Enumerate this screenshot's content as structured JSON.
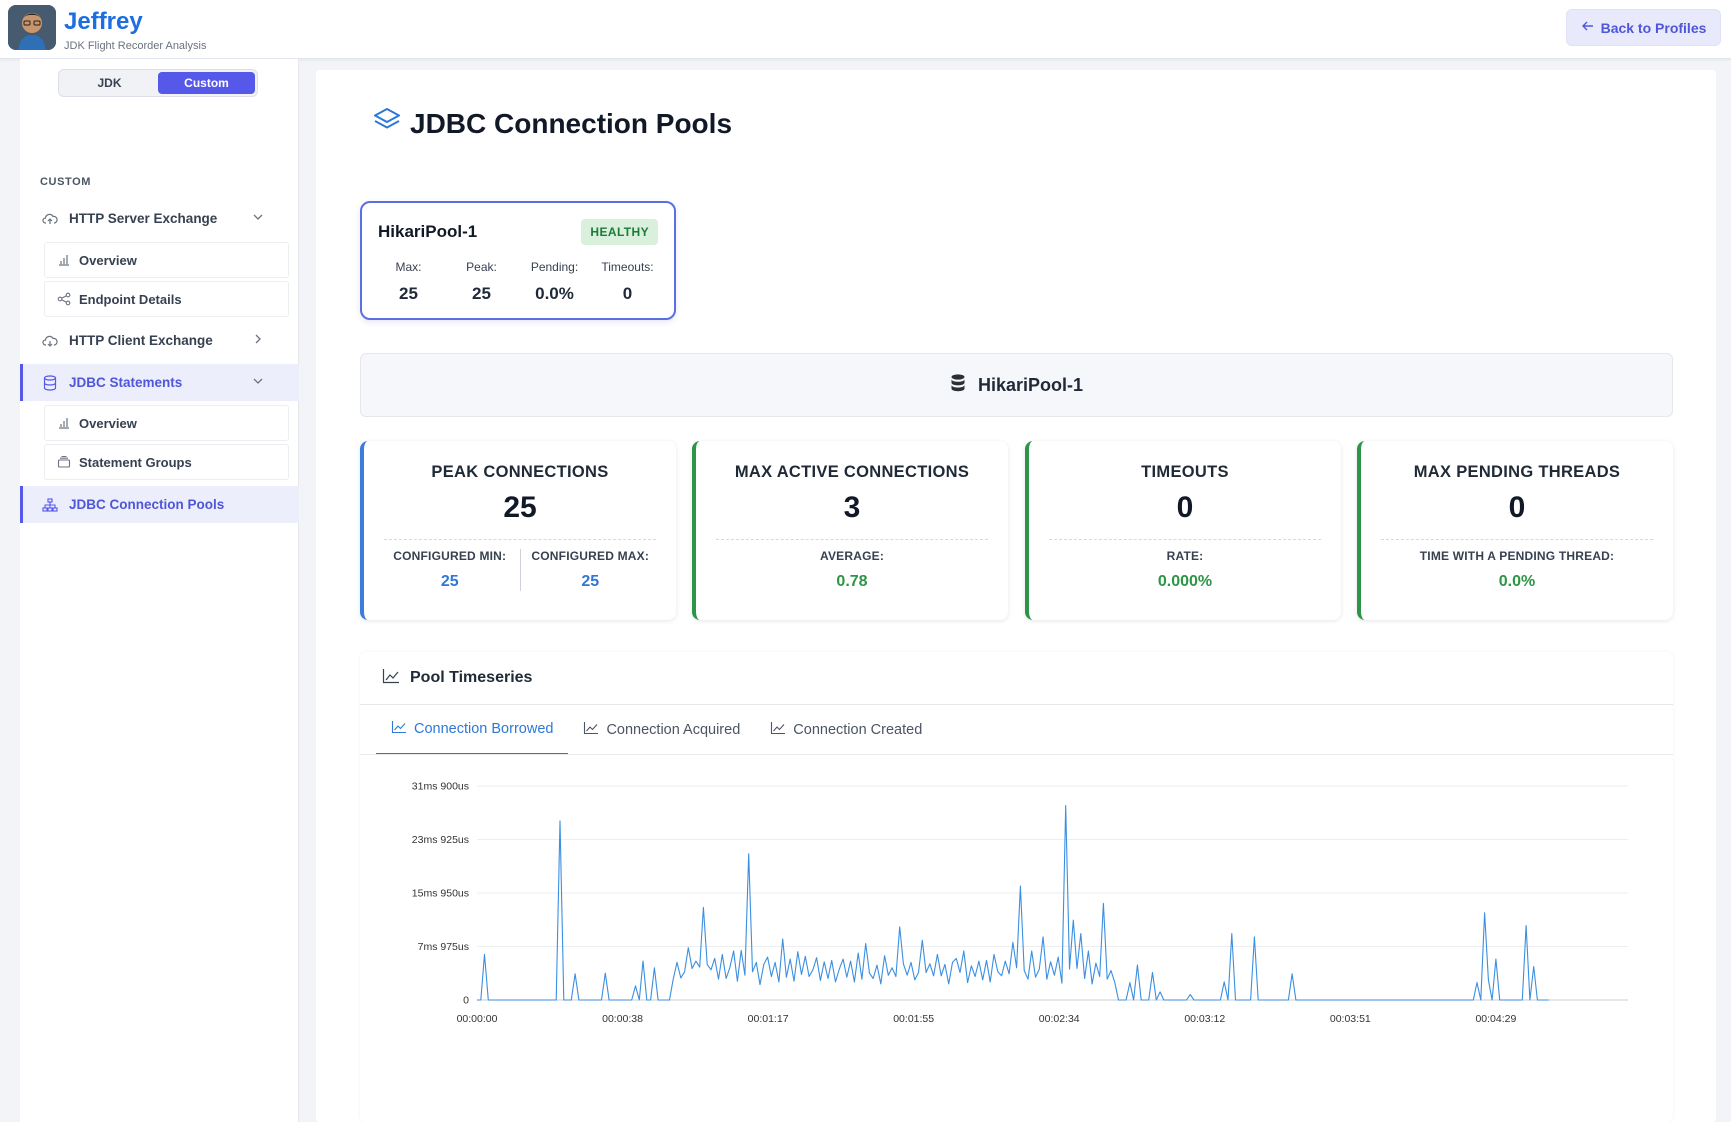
{
  "app": {
    "title": "Jeffrey",
    "subtitle": "JDK Flight Recorder Analysis",
    "back_label": "Back to Profiles"
  },
  "sidebar": {
    "toggle": [
      "JDK",
      "Custom"
    ],
    "section_label": "CUSTOM",
    "groups": [
      {
        "label": "HTTP Server Exchange",
        "icon": "cloud-upload-icon",
        "expanded": true,
        "items": [
          {
            "label": "Overview",
            "icon": "bar-chart-icon"
          },
          {
            "label": "Endpoint Details",
            "icon": "share-icon"
          }
        ]
      },
      {
        "label": "HTTP Client Exchange",
        "icon": "cloud-download-icon",
        "expanded": false,
        "items": []
      },
      {
        "label": "JDBC Statements",
        "icon": "database-icon",
        "expanded": true,
        "items": [
          {
            "label": "Overview",
            "icon": "bar-chart-icon"
          },
          {
            "label": "Statement Groups",
            "icon": "collection-icon"
          }
        ]
      },
      {
        "label": "JDBC Connection Pools",
        "icon": "diagram-icon",
        "active": true,
        "items": []
      }
    ]
  },
  "page": {
    "title": "JDBC Connection Pools"
  },
  "pool_card": {
    "name": "HikariPool-1",
    "status": "HEALTHY",
    "stats": [
      {
        "label": "Max:",
        "value": "25"
      },
      {
        "label": "Peak:",
        "value": "25"
      },
      {
        "label": "Pending:",
        "value": "0.0%"
      },
      {
        "label": "Timeouts:",
        "value": "0"
      }
    ]
  },
  "pool_header": {
    "name": "HikariPool-1"
  },
  "metrics": [
    {
      "title": "PEAK CONNECTIONS",
      "value": "25",
      "accent": "#3b7ddd",
      "subs": [
        {
          "label": "CONFIGURED MIN:",
          "value": "25"
        },
        {
          "label": "CONFIGURED MAX:",
          "value": "25"
        }
      ]
    },
    {
      "title": "MAX ACTIVE CONNECTIONS",
      "value": "3",
      "accent": "#2e9447",
      "subs": [
        {
          "label": "AVERAGE:",
          "value": "0.78"
        }
      ]
    },
    {
      "title": "TIMEOUTS",
      "value": "0",
      "accent": "#2e9447",
      "subs": [
        {
          "label": "RATE:",
          "value": "0.000%"
        }
      ]
    },
    {
      "title": "MAX PENDING THREADS",
      "value": "0",
      "accent": "#2e9447",
      "subs": [
        {
          "label": "TIME WITH A PENDING THREAD:",
          "value": "0.0%"
        }
      ]
    }
  ],
  "timeseries": {
    "title": "Pool Timeseries",
    "tabs": [
      "Connection Borrowed",
      "Connection Acquired",
      "Connection Created"
    ],
    "active_tab": 0
  },
  "chart_data": {
    "type": "line",
    "title": "",
    "xlabel": "",
    "ylabel": "",
    "x_ticks": [
      "00:00:00",
      "00:00:38",
      "00:01:17",
      "00:01:55",
      "00:02:34",
      "00:03:12",
      "00:03:51",
      "00:04:29"
    ],
    "y_ticks": [
      "0",
      "7ms 975us",
      "15ms 950us",
      "23ms 925us",
      "31ms 900us"
    ],
    "ylim_ms": [
      0,
      31.9
    ],
    "x_range_s": [
      0,
      305
    ],
    "line_color": "#3b8fe0",
    "series": [
      {
        "name": "",
        "points_s_ms": [
          [
            0,
            0
          ],
          [
            1,
            0
          ],
          [
            2,
            6.8
          ],
          [
            3,
            0
          ],
          [
            21,
            0
          ],
          [
            22,
            26.7
          ],
          [
            23,
            0
          ],
          [
            25,
            0
          ],
          [
            26,
            3.9
          ],
          [
            27,
            0
          ],
          [
            33,
            0
          ],
          [
            34,
            4
          ],
          [
            35,
            0
          ],
          [
            41,
            0
          ],
          [
            42,
            2.1
          ],
          [
            43,
            0
          ],
          [
            44,
            5.8
          ],
          [
            45,
            0
          ],
          [
            46,
            0
          ],
          [
            47,
            4.8
          ],
          [
            48,
            0
          ],
          [
            51,
            0
          ],
          [
            52,
            3.1
          ],
          [
            53,
            5.6
          ],
          [
            54,
            3.3
          ],
          [
            55,
            4.2
          ],
          [
            56,
            7.8
          ],
          [
            57,
            4.7
          ],
          [
            58,
            5.8
          ],
          [
            59,
            4.9
          ],
          [
            60,
            13.8
          ],
          [
            61,
            5.3
          ],
          [
            62,
            4.5
          ],
          [
            63,
            6.2
          ],
          [
            64,
            3.1
          ],
          [
            65,
            6.8
          ],
          [
            66,
            3.2
          ],
          [
            67,
            4.8
          ],
          [
            68,
            7.3
          ],
          [
            69,
            2.8
          ],
          [
            70,
            7.4
          ],
          [
            71,
            3.7
          ],
          [
            72,
            21.8
          ],
          [
            73,
            4.2
          ],
          [
            74,
            5.6
          ],
          [
            75,
            2.3
          ],
          [
            76,
            5.3
          ],
          [
            77,
            6.4
          ],
          [
            78,
            3.5
          ],
          [
            79,
            5.6
          ],
          [
            80,
            2.7
          ],
          [
            81,
            9.1
          ],
          [
            82,
            3.4
          ],
          [
            83,
            6.1
          ],
          [
            84,
            2.8
          ],
          [
            85,
            7.2
          ],
          [
            86,
            3.8
          ],
          [
            87,
            6.5
          ],
          [
            88,
            3.5
          ],
          [
            89,
            4.5
          ],
          [
            90,
            6.3
          ],
          [
            91,
            2.9
          ],
          [
            92,
            5.7
          ],
          [
            93,
            3.2
          ],
          [
            94,
            5.9
          ],
          [
            95,
            2.7
          ],
          [
            96,
            4.6
          ],
          [
            97,
            6.1
          ],
          [
            98,
            3.4
          ],
          [
            99,
            5.8
          ],
          [
            100,
            2.7
          ],
          [
            101,
            7
          ],
          [
            102,
            3.1
          ],
          [
            103,
            8.4
          ],
          [
            104,
            4
          ],
          [
            105,
            3.2
          ],
          [
            106,
            5.2
          ],
          [
            107,
            2.4
          ],
          [
            108,
            6.6
          ],
          [
            109,
            3.7
          ],
          [
            110,
            4.8
          ],
          [
            111,
            3.5
          ],
          [
            112,
            10.9
          ],
          [
            113,
            5.4
          ],
          [
            114,
            3.7
          ],
          [
            115,
            5.6
          ],
          [
            116,
            3
          ],
          [
            117,
            4.1
          ],
          [
            118,
            8.9
          ],
          [
            119,
            4.1
          ],
          [
            120,
            5.4
          ],
          [
            121,
            3.6
          ],
          [
            122,
            6.8
          ],
          [
            123,
            3.6
          ],
          [
            124,
            5.3
          ],
          [
            125,
            2.4
          ],
          [
            126,
            5.6
          ],
          [
            127,
            6.2
          ],
          [
            128,
            4.1
          ],
          [
            129,
            7.3
          ],
          [
            130,
            2.6
          ],
          [
            131,
            5.1
          ],
          [
            132,
            3.5
          ],
          [
            133,
            5.8
          ],
          [
            134,
            3
          ],
          [
            135,
            5.9
          ],
          [
            136,
            2.7
          ],
          [
            137,
            6.8
          ],
          [
            138,
            4.2
          ],
          [
            139,
            3.6
          ],
          [
            140,
            5.8
          ],
          [
            141,
            3.9
          ],
          [
            142,
            8.6
          ],
          [
            143,
            4.8
          ],
          [
            144,
            17
          ],
          [
            145,
            4.4
          ],
          [
            146,
            3.1
          ],
          [
            147,
            7.3
          ],
          [
            148,
            3.4
          ],
          [
            149,
            4.6
          ],
          [
            150,
            9.4
          ],
          [
            151,
            3.1
          ],
          [
            152,
            5.7
          ],
          [
            153,
            3.7
          ],
          [
            154,
            6.4
          ],
          [
            155,
            2.5
          ],
          [
            156,
            29
          ],
          [
            157,
            4.6
          ],
          [
            158,
            11.9
          ],
          [
            159,
            4.7
          ],
          [
            160,
            9.9
          ],
          [
            161,
            3.2
          ],
          [
            162,
            7.3
          ],
          [
            163,
            2.4
          ],
          [
            164,
            5.5
          ],
          [
            165,
            3.5
          ],
          [
            166,
            14.4
          ],
          [
            167,
            3.1
          ],
          [
            168,
            4.4
          ],
          [
            169,
            2.6
          ],
          [
            170,
            0
          ],
          [
            172,
            0
          ],
          [
            173,
            2.6
          ],
          [
            174,
            0
          ],
          [
            175,
            5.2
          ],
          [
            176,
            0
          ],
          [
            178,
            0
          ],
          [
            179,
            4.1
          ],
          [
            180,
            0
          ],
          [
            181,
            1.2
          ],
          [
            182,
            0
          ],
          [
            188,
            0
          ],
          [
            189,
            0.8
          ],
          [
            190,
            0
          ],
          [
            197,
            0
          ],
          [
            198,
            2.7
          ],
          [
            199,
            0
          ],
          [
            200,
            9.9
          ],
          [
            201,
            0
          ],
          [
            205,
            0
          ],
          [
            206,
            9.4
          ],
          [
            207,
            0
          ],
          [
            215,
            0
          ],
          [
            216,
            3.9
          ],
          [
            217,
            0
          ],
          [
            264,
            0
          ],
          [
            265,
            2.6
          ],
          [
            266,
            0
          ],
          [
            267,
            13
          ],
          [
            268,
            3
          ],
          [
            269,
            0
          ],
          [
            270,
            6.1
          ],
          [
            271,
            0
          ],
          [
            277,
            0
          ],
          [
            278,
            11.1
          ],
          [
            279,
            0
          ],
          [
            280,
            5
          ],
          [
            281,
            0
          ],
          [
            284,
            0
          ]
        ]
      }
    ]
  }
}
